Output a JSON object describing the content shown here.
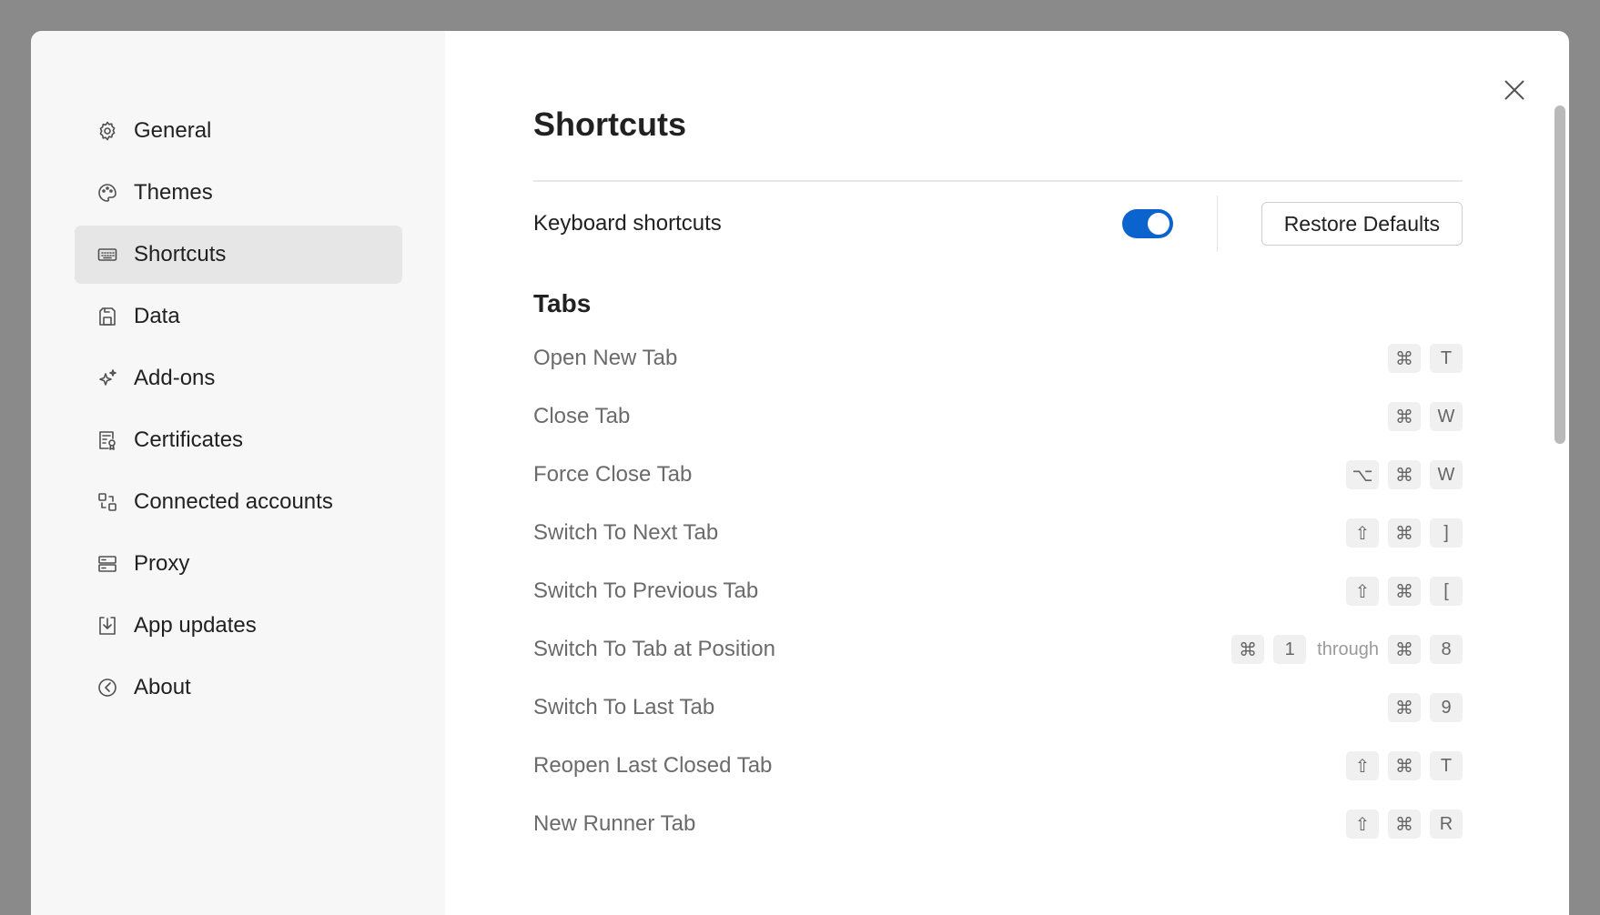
{
  "sidebar": {
    "items": [
      {
        "label": "General",
        "icon": "gear-icon",
        "active": false
      },
      {
        "label": "Themes",
        "icon": "palette-icon",
        "active": false
      },
      {
        "label": "Shortcuts",
        "icon": "keyboard-icon",
        "active": true
      },
      {
        "label": "Data",
        "icon": "data-icon",
        "active": false
      },
      {
        "label": "Add-ons",
        "icon": "sparkles-icon",
        "active": false
      },
      {
        "label": "Certificates",
        "icon": "certificate-icon",
        "active": false
      },
      {
        "label": "Connected accounts",
        "icon": "connected-icon",
        "active": false
      },
      {
        "label": "Proxy",
        "icon": "proxy-icon",
        "active": false
      },
      {
        "label": "App updates",
        "icon": "download-icon",
        "active": false
      },
      {
        "label": "About",
        "icon": "about-icon",
        "active": false
      }
    ]
  },
  "main": {
    "title": "Shortcuts",
    "keyboard_shortcuts_label": "Keyboard shortcuts",
    "keyboard_shortcuts_enabled": true,
    "restore_defaults_label": "Restore Defaults",
    "section_title": "Tabs",
    "through_label": "through",
    "shortcuts": [
      {
        "name": "Open New Tab",
        "keys": [
          "⌘",
          "T"
        ]
      },
      {
        "name": "Close Tab",
        "keys": [
          "⌘",
          "W"
        ]
      },
      {
        "name": "Force Close Tab",
        "keys": [
          "⌥",
          "⌘",
          "W"
        ]
      },
      {
        "name": "Switch To Next Tab",
        "keys": [
          "⇧",
          "⌘",
          "]"
        ]
      },
      {
        "name": "Switch To Previous Tab",
        "keys": [
          "⇧",
          "⌘",
          "["
        ]
      },
      {
        "name": "Switch To Tab at Position",
        "keys": [
          "⌘",
          "1"
        ],
        "through_keys": [
          "⌘",
          "8"
        ]
      },
      {
        "name": "Switch To Last Tab",
        "keys": [
          "⌘",
          "9"
        ]
      },
      {
        "name": "Reopen Last Closed Tab",
        "keys": [
          "⇧",
          "⌘",
          "T"
        ]
      },
      {
        "name": "New Runner Tab",
        "keys": [
          "⇧",
          "⌘",
          "R"
        ]
      }
    ]
  },
  "colors": {
    "accent": "#0b63ce",
    "sidebar_bg": "#f7f7f7",
    "active_item_bg": "#e6e6e6",
    "overlay": "#8a8a8a"
  }
}
